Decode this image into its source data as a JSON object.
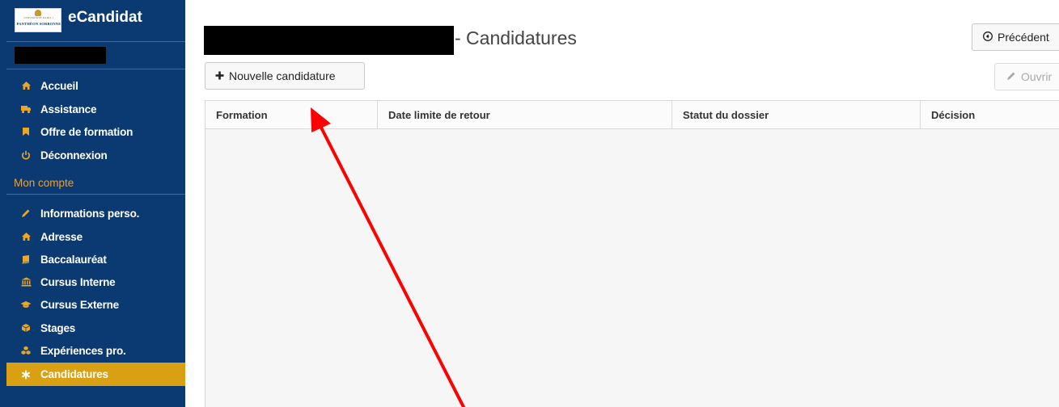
{
  "sidebar": {
    "logo": {
      "small_text": "UNIVERSITÉ PARIS 1",
      "name_text": "PANTHÉON SORBONNE",
      "icon": "university-crest"
    },
    "app_title": "eCandidat",
    "nav": [
      {
        "label": "Accueil",
        "icon": "home-icon"
      },
      {
        "label": "Assistance",
        "icon": "truck-icon"
      },
      {
        "label": "Offre de formation",
        "icon": "bookmark-icon"
      },
      {
        "label": "Déconnexion",
        "icon": "power-icon"
      }
    ],
    "section_title": "Mon compte",
    "account_nav": [
      {
        "label": "Informations perso.",
        "icon": "pencil-icon"
      },
      {
        "label": "Adresse",
        "icon": "home-icon"
      },
      {
        "label": "Baccalauréat",
        "icon": "book-icon"
      },
      {
        "label": "Cursus Interne",
        "icon": "institution-icon"
      },
      {
        "label": "Cursus Externe",
        "icon": "graduation-cap-icon"
      },
      {
        "label": "Stages",
        "icon": "cube-icon"
      },
      {
        "label": "Expériences pro.",
        "icon": "cubes-icon"
      },
      {
        "label": "Candidatures",
        "icon": "asterisk-icon",
        "active": true
      }
    ]
  },
  "main": {
    "title": "- Candidatures",
    "buttons": {
      "previous": "Précédent",
      "new_application": "Nouvelle candidature",
      "open": "Ouvrir"
    },
    "table": {
      "columns": [
        "Formation",
        "Date limite de retour",
        "Statut du dossier",
        "Décision"
      ],
      "rows": []
    }
  },
  "colors": {
    "sidebar_bg": "#0b3a72",
    "accent": "#d9a013",
    "icon": "#e8a826",
    "annotation_arrow": "#ff0000"
  }
}
